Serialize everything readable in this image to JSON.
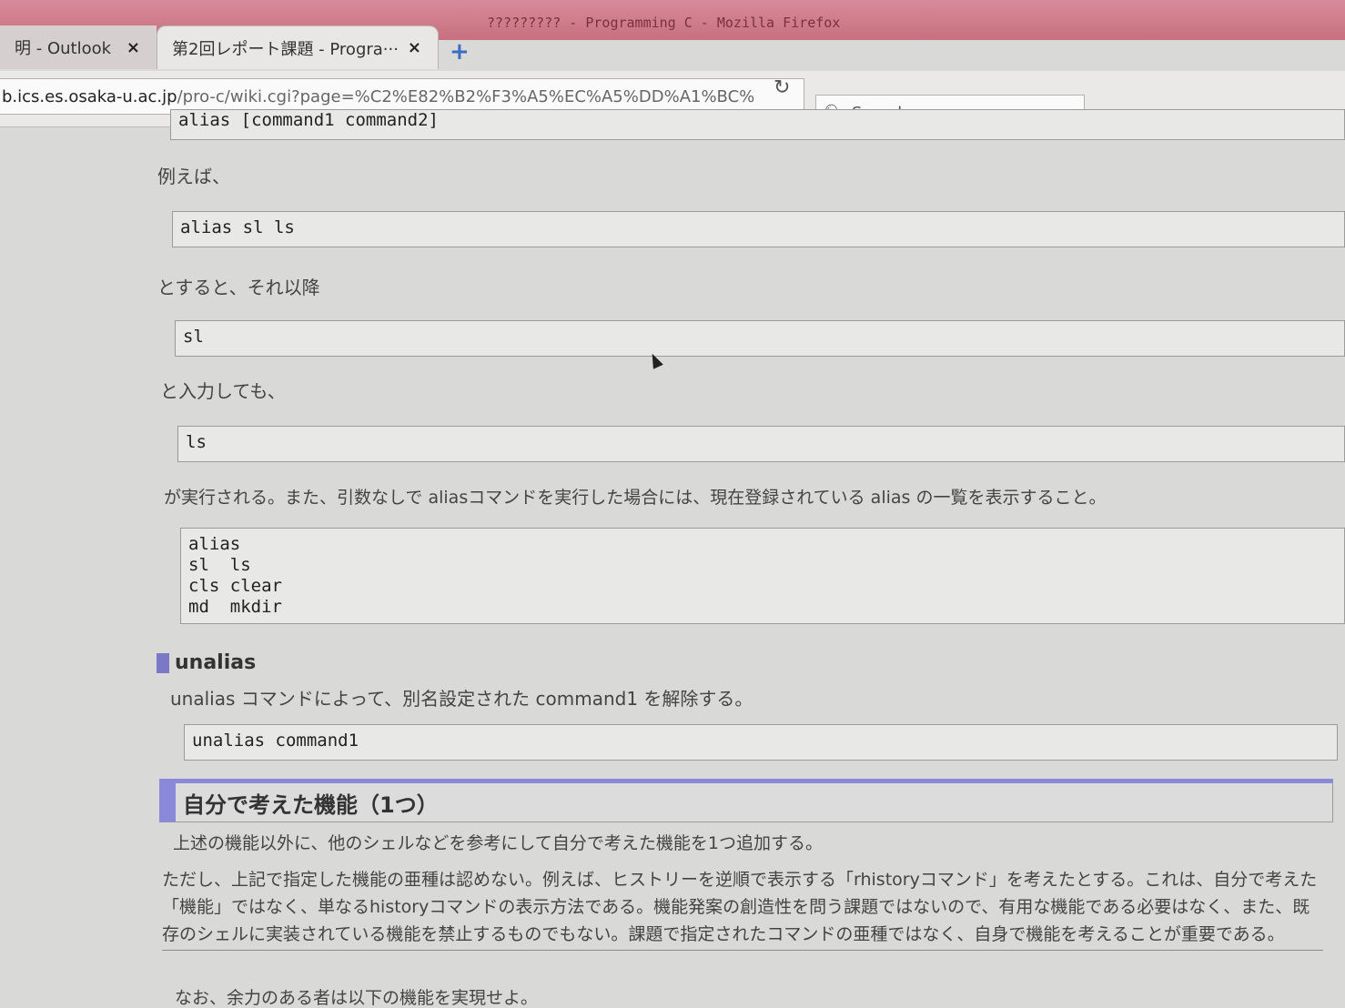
{
  "window": {
    "title": "????????? - Programming C - Mozilla Firefox"
  },
  "tabs": [
    {
      "label": "明 - Outlook",
      "close": "×"
    },
    {
      "label": "第2回レポート課題 - Progra···",
      "close": "×"
    }
  ],
  "new_tab": "+",
  "nav": {
    "url_host": "b.ics.es.osaka-u.ac.jp",
    "url_path": "/pro-c/wiki.cgi?page=%C2%E82%B2%F3%A5%EC%A5%DD%A1%BC%",
    "search_placeholder": "Search"
  },
  "content": {
    "code_top": "alias [command1 command2]",
    "p_example": "例えば、",
    "code_alias_sl": "alias sl ls",
    "p_then": "とすると、それ以降",
    "code_sl": "sl",
    "p_input": "と入力しても、",
    "code_ls": "ls",
    "p_executed": "が実行される。また、引数なしで aliasコマンドを実行した場合には、現在登録されている alias の一覧を表示すること。",
    "code_list": "alias\nsl  ls\ncls clear\nmd  mkdir",
    "h_unalias": "unalias",
    "p_unalias": "unalias コマンドによって、別名設定された command1 を解除する。",
    "code_unalias": "unalias command1",
    "h_own": "自分で考えた機能（1つ）",
    "p_own": "上述の機能以外に、他のシェルなどを参考にして自分で考えた機能を1つ追加する。",
    "p_note": "ただし、上記で指定した機能の亜種は認めない。例えば、ヒストリーを逆順で表示する「rhistoryコマンド」を考えたとする。これは、自分で考えた「機能」ではなく、単なるhistoryコマンドの表示方法である。機能発案の創造性を問う課題ではないので、有用な機能である必要はなく、また、既存のシェルに実装されている機能を禁止するものでもない。課題で指定されたコマンドの亜種ではなく、自身で機能を考えることが重要である。",
    "p_extra": "なお、余力のある者は以下の機能を実現せよ。"
  },
  "colors": {
    "heading_accent": "#8a88d8",
    "titlebar": "#c7707f"
  }
}
